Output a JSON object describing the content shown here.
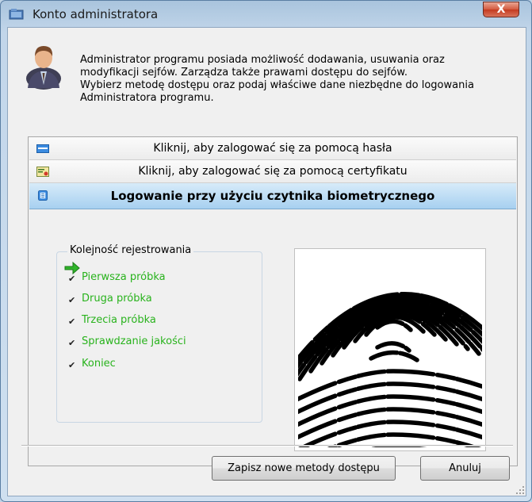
{
  "window": {
    "title": "Konto administratora",
    "close_label": "X"
  },
  "intro": {
    "lines": [
      "Administrator programu posiada możliwość dodawania, usuwania oraz",
      "modyfikacji sejfów. Zarządza także prawami dostępu do sejfów.",
      "Wybierz metodę dostępu oraz podaj właściwe dane niezbędne do logowania",
      "Administratora programu."
    ]
  },
  "methods": [
    {
      "label": "Kliknij, aby zalogować się za pomocą hasła",
      "icon": "password-icon",
      "active": false
    },
    {
      "label": "Kliknij, aby zalogować się za pomocą certyfikatu",
      "icon": "certificate-icon",
      "active": false
    },
    {
      "label": "Logowanie przy użyciu czytnika biometrycznego",
      "icon": "biometric-reader-icon",
      "active": true
    }
  ],
  "registration": {
    "title": "Kolejność rejestrowania",
    "steps": [
      "Pierwsza próbka",
      "Druga próbka",
      "Trzecia próbka",
      "Sprawdzanie jakości",
      "Koniec"
    ],
    "step_color": "#29b31d"
  },
  "buttons": {
    "save": "Zapisz nowe metody dostępu",
    "cancel": "Anuluj"
  },
  "colors": {
    "active_method_bg": "#b9dcf5",
    "close_button": "#c9452a"
  }
}
